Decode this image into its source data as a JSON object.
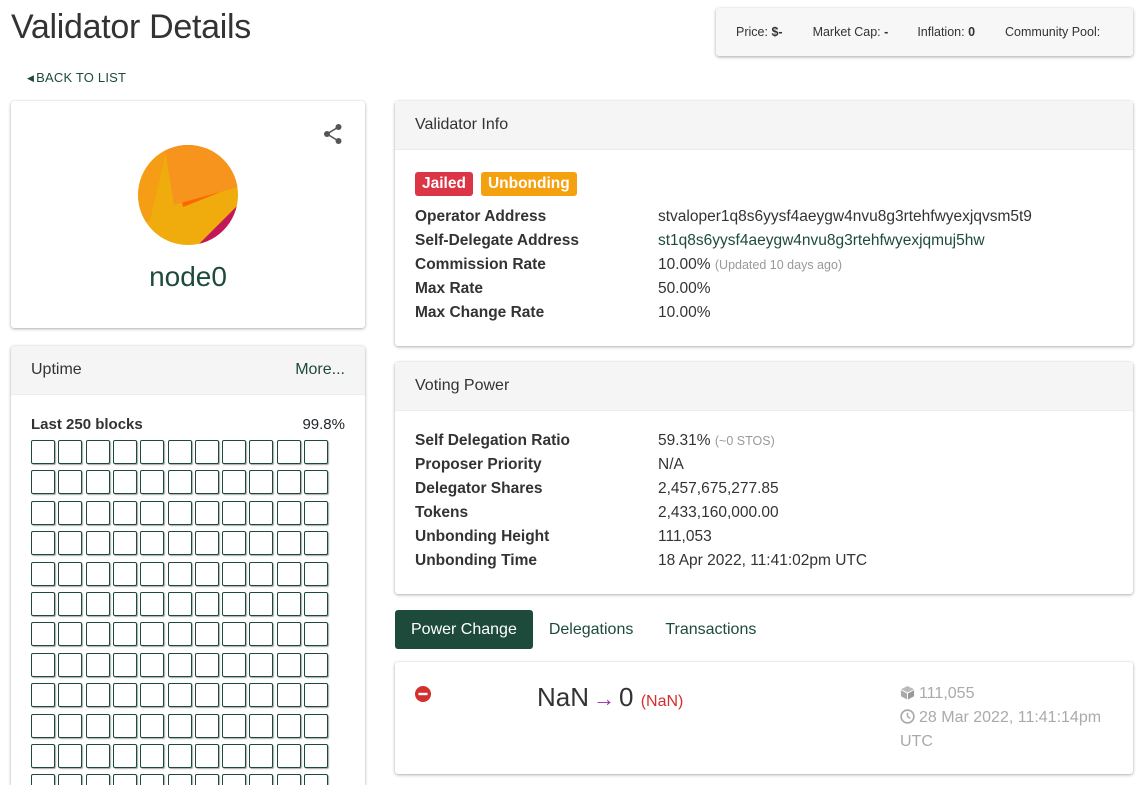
{
  "page": {
    "title": "Validator Details"
  },
  "stats": {
    "price_label": "Price:",
    "price_value": "$-",
    "market_cap_label": "Market Cap:",
    "market_cap_value": "-",
    "inflation_label": "Inflation:",
    "inflation_value": "0",
    "community_pool_label": "Community Pool:",
    "community_pool_value": ""
  },
  "nav": {
    "back_label": "BACK TO LIST"
  },
  "profile": {
    "moniker": "node0",
    "avatar_colors": [
      "#f7941d",
      "#fe6400",
      "#f0ab0c",
      "#c2185b"
    ]
  },
  "uptime": {
    "title": "Uptime",
    "more_label": "More...",
    "blocks_label": "Last 250 blocks",
    "percentage": "99.8%",
    "visible_rows": 12,
    "columns": 11
  },
  "validator_info": {
    "title": "Validator Info",
    "badges": [
      {
        "label": "Jailed",
        "color": "#dc3545"
      },
      {
        "label": "Unbonding",
        "color": "#f5a00f"
      }
    ],
    "operator_address_label": "Operator Address",
    "operator_address": "stvaloper1q8s6yysf4aeygw4nvu8g3rtehfwyexjqvsm5t9",
    "self_delegate_label": "Self-Delegate Address",
    "self_delegate_address": "st1q8s6yysf4aeygw4nvu8g3rtehfwyexjqmuj5hw",
    "commission_rate_label": "Commission Rate",
    "commission_rate": "10.00%",
    "commission_updated": "(Updated 10 days ago)",
    "max_rate_label": "Max Rate",
    "max_rate": "50.00%",
    "max_change_rate_label": "Max Change Rate",
    "max_change_rate": "10.00%"
  },
  "voting_power": {
    "title": "Voting Power",
    "self_delegation_ratio_label": "Self Delegation Ratio",
    "self_delegation_ratio": "59.31%",
    "self_delegation_amount": "(~0 STOS)",
    "proposer_priority_label": "Proposer Priority",
    "proposer_priority": "N/A",
    "delegator_shares_label": "Delegator Shares",
    "delegator_shares": "2,457,675,277.85",
    "tokens_label": "Tokens",
    "tokens": "2,433,160,000.00",
    "unbonding_height_label": "Unbonding Height",
    "unbonding_height": "111,053",
    "unbonding_time_label": "Unbonding Time",
    "unbonding_time": "18 Apr 2022, 11:41:02pm UTC"
  },
  "tabs": [
    {
      "label": "Power Change"
    },
    {
      "label": "Delegations"
    },
    {
      "label": "Transactions"
    }
  ],
  "power_change": {
    "from": "NaN",
    "to": "0",
    "pct": "(NaN)",
    "block_height": "111,055",
    "time_line1": "28 Mar 2022, 11:41:14pm",
    "time_line2": "UTC"
  },
  "colors": {
    "brand": "#1e4a3c",
    "jailed": "#dc3545",
    "unbonding": "#f5a00f",
    "negative": "#d32f2f",
    "arrow": "#9c27b0"
  }
}
